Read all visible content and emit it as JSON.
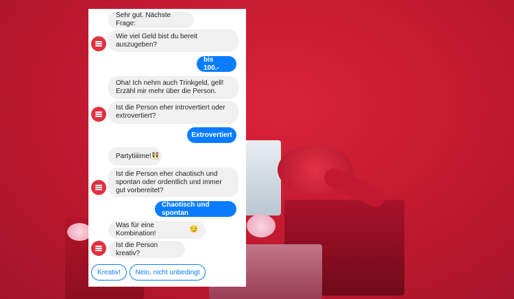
{
  "messages": {
    "m1": "Sehr gut. Nächste Frage:",
    "m2": "Wie viel Geld bist du bereit auszugeben?",
    "u1": "bis 100.-",
    "m3": "Oha! Ich nehm auch Trinkgeld, gell! Erzähl mir mehr über die Person.",
    "m4": "Ist die Person eher introvertiert oder extrovertiert?",
    "u2": "Extrovertiert",
    "m5": "Partytiiiime!",
    "m5_emoji": "👯",
    "m6": "Ist die Person eher chaotisch und spontan oder ordentlich und immer gut vorbereitet?",
    "u3": "Chaotisch und spontan",
    "m7": "Was für eine Kombination!",
    "m7_emoji": "😏",
    "m8": "Ist die Person kreativ?"
  },
  "quick_replies": [
    "Kreativ!",
    "Nein, nicht unbedingt"
  ],
  "colors": {
    "user_bubble": "#0a7cff",
    "bot_bubble": "#f1f0f0",
    "avatar": "#e0313f",
    "background": "#c41a30"
  },
  "icons": {
    "avatar": "menu-lines-icon"
  }
}
